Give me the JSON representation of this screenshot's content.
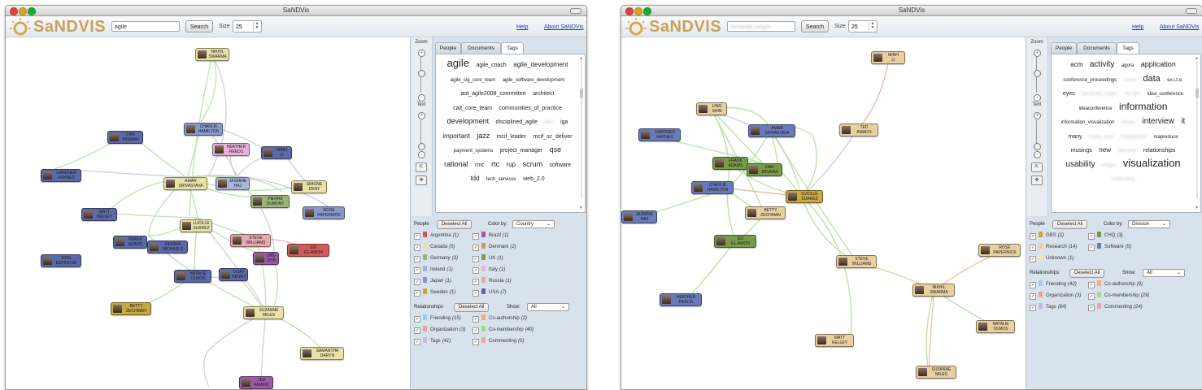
{
  "windows": [
    {
      "title": "SaNDVis",
      "logo": "SaNDVIS",
      "search": {
        "value": "agile",
        "placeholder": "",
        "button": "Search"
      },
      "size": {
        "label": "Size",
        "value": "25"
      },
      "links": {
        "help": "Help",
        "about": "About SaNDVis"
      },
      "zoom": {
        "zoom_label": "Zoom",
        "text_label": "Text"
      },
      "tabs": [
        {
          "label": "People",
          "active": false
        },
        {
          "label": "Documents",
          "active": false
        },
        {
          "label": "Tags",
          "active": true
        }
      ],
      "tags": [
        {
          "text": "agile",
          "size": 13,
          "blur": false
        },
        {
          "text": "agile_coach",
          "size": 7,
          "blur": false
        },
        {
          "text": "agile_development",
          "size": 8,
          "blur": false
        },
        {
          "text": "agile_sig_core_team",
          "size": 6,
          "blur": false
        },
        {
          "text": "agile_software_development",
          "size": 6,
          "blur": false
        },
        {
          "text": "aot_agile2008_committee",
          "size": 7,
          "blur": false
        },
        {
          "text": "architect",
          "size": 7,
          "blur": false
        },
        {
          "text": "cait_core_team",
          "size": 7,
          "blur": false
        },
        {
          "text": "communities_of_practice",
          "size": 7,
          "blur": false
        },
        {
          "text": "development",
          "size": 9,
          "blur": false
        },
        {
          "text": "disciplined_agile",
          "size": 7,
          "blur": false
        },
        {
          "text": "ibm",
          "size": 7,
          "blur": true
        },
        {
          "text": "iga",
          "size": 7,
          "blur": false
        },
        {
          "text": "important",
          "size": 8,
          "blur": false
        },
        {
          "text": "jazz",
          "size": 9,
          "blur": false
        },
        {
          "text": "mcif_leader",
          "size": 7,
          "blur": false
        },
        {
          "text": "mcif_sc_deliver",
          "size": 7,
          "blur": false
        },
        {
          "text": "payment_systems",
          "size": 6,
          "blur": false
        },
        {
          "text": "project_manager",
          "size": 7,
          "blur": false
        },
        {
          "text": "qse",
          "size": 9,
          "blur": false
        },
        {
          "text": "rational",
          "size": 9,
          "blur": false
        },
        {
          "text": "rmc",
          "size": 7,
          "blur": false
        },
        {
          "text": "rtc",
          "size": 9,
          "blur": false
        },
        {
          "text": "rup",
          "size": 8,
          "blur": false
        },
        {
          "text": "scrum",
          "size": 9,
          "blur": false
        },
        {
          "text": "software",
          "size": 7,
          "blur": false
        },
        {
          "text": "tdd",
          "size": 8,
          "blur": false
        },
        {
          "text": "tech_services",
          "size": 6,
          "blur": false
        },
        {
          "text": "web_2.0",
          "size": 7,
          "blur": false
        }
      ],
      "people_section": {
        "label": "People",
        "deselect": "Deselect All",
        "colorby_label": "Color by:",
        "colorby_value": "Country"
      },
      "people_items": [
        {
          "label": "Argentina",
          "count": "(1)",
          "color": "#d15a5a"
        },
        {
          "label": "Brazil",
          "count": "(1)",
          "color": "#9a5aa8"
        },
        {
          "label": "Canada",
          "count": "(5)",
          "color": "#e8e2a8"
        },
        {
          "label": "Denmark",
          "count": "(2)",
          "color": "#c0a070"
        },
        {
          "label": "Germany",
          "count": "(3)",
          "color": "#9ab47a"
        },
        {
          "label": "UK",
          "count": "(1)",
          "color": "#7a9a4a"
        },
        {
          "label": "Ireland",
          "count": "(1)",
          "color": "#a8b4d8"
        },
        {
          "label": "Italy",
          "count": "(1)",
          "color": "#e8b0d8"
        },
        {
          "label": "Japan",
          "count": "(1)",
          "color": "#8898cc"
        },
        {
          "label": "Russia",
          "count": "(1)",
          "color": "#e8a8b0"
        },
        {
          "label": "Sweden",
          "count": "(1)",
          "color": "#c8a840"
        },
        {
          "label": "USA",
          "count": "(7)",
          "color": "#5a6aa8"
        }
      ],
      "rel_section": {
        "label": "Relationships",
        "deselect": "Deselect All",
        "show_label": "Show:",
        "show_value": "All"
      },
      "rel_items": [
        {
          "label": "Friending",
          "count": "(15)",
          "color": "#a8c8e8"
        },
        {
          "label": "Co-authorship",
          "count": "(2)",
          "color": "#f0b080"
        },
        {
          "label": "Organization",
          "count": "(3)",
          "color": "#e8a0a0"
        },
        {
          "label": "Co-membership",
          "count": "(40)",
          "color": "#a8d890"
        },
        {
          "label": "Tags",
          "count": "(41)",
          "color": "#c8b8e0"
        },
        {
          "label": "Commenting",
          "count": "(0)",
          "color": "#e8a8a8"
        }
      ],
      "nodes": [
        {
          "line1": "NIKHIL",
          "line2": "SWARMA",
          "color": "#e8e2a8"
        },
        {
          "line1": "CHARLIE",
          "line2": "HAMILTON",
          "color": "#8898cc"
        },
        {
          "line1": "DAN",
          "line2": "MISAWA",
          "color": "#5a6aa8"
        },
        {
          "line1": "HEATHER",
          "line2": "REEDS",
          "color": "#e8b0d8"
        },
        {
          "line1": "MINH",
          "line2": "LI",
          "color": "#5a6aa8"
        },
        {
          "line1": "GARDNER",
          "line2": "RAYNES",
          "color": "#5a6aa8"
        },
        {
          "line1": "AMAR",
          "line2": "SRIVASTAVA",
          "color": "#e8e2a8"
        },
        {
          "line1": "JASMINE",
          "line2": "HAJ",
          "color": "#a8b4d8"
        },
        {
          "line1": "SIMONE",
          "line2": "DRAY",
          "color": "#e8e2a8"
        },
        {
          "line1": "PIERRE",
          "line2": "DUMONT",
          "color": "#9ab47a"
        },
        {
          "line1": "ROSE",
          "line2": "PAPERNICK",
          "color": "#8898cc"
        },
        {
          "line1": "MATT",
          "line2": "KELLEY",
          "color": "#5a6aa8"
        },
        {
          "line1": "LUCILLE",
          "line2": "SUAREZ",
          "color": "#e8e2a8"
        },
        {
          "line1": "FRANK",
          "line2": "ADAMS",
          "color": "#5a6aa8"
        },
        {
          "line1": "DENNIS",
          "line2": "MICHAELS",
          "color": "#5a6aa8"
        },
        {
          "line1": "STEVE",
          "line2": "WILLIAMS",
          "color": "#e8a8b0"
        },
        {
          "line1": "LING",
          "line2": "SHIN",
          "color": "#9a5aa8"
        },
        {
          "line1": "ED",
          "line2": "EL-AMON",
          "color": "#d15a5a"
        },
        {
          "line1": "RON",
          "line2": "ESPINOSA",
          "color": "#5a6aa8"
        },
        {
          "line1": "NATALIE",
          "line2": "OLMOS",
          "color": "#5a6aa8"
        },
        {
          "line1": "VIJAY",
          "line2": "HENRY",
          "color": "#5a6aa8"
        },
        {
          "line1": "BETTY",
          "line2": "ZECHMAN",
          "color": "#c8a840"
        },
        {
          "line1": "SUZANNE",
          "line2": "MILES",
          "color": "#e8e2a8"
        },
        {
          "line1": "SAMANTHA",
          "line2": "DARYN",
          "color": "#e8e2a8"
        },
        {
          "line1": "TED",
          "line2": "AMADO",
          "color": "#9a5aa8"
        }
      ]
    },
    {
      "title": "SaNDVis",
      "logo": "SaNDVIS",
      "search": {
        "value": "fernanda viegas",
        "placeholder": "",
        "button": "Search"
      },
      "size": {
        "label": "Size",
        "value": "25"
      },
      "links": {
        "help": "Help",
        "about": "About SaNDVis"
      },
      "zoom": {
        "zoom_label": "Zoom",
        "text_label": "Text"
      },
      "tabs": [
        {
          "label": "People",
          "active": false
        },
        {
          "label": "Documents",
          "active": false
        },
        {
          "label": "Tags",
          "active": true
        }
      ],
      "tags": [
        {
          "text": "acm",
          "size": 8,
          "blur": false
        },
        {
          "text": "activity",
          "size": 10,
          "blur": false
        },
        {
          "text": "agora",
          "size": 6,
          "blur": false
        },
        {
          "text": "application",
          "size": 9,
          "blur": false
        },
        {
          "text": "conference_proceedings",
          "size": 6,
          "blur": false
        },
        {
          "text": "social",
          "size": 6,
          "blur": true
        },
        {
          "text": "data",
          "size": 11,
          "blur": false
        },
        {
          "text": "ex.i.t.e.",
          "size": 6,
          "blur": false
        },
        {
          "text": "eyes",
          "size": 7,
          "blur": false
        },
        {
          "text": "fernanda_viegas",
          "size": 6,
          "blur": true
        },
        {
          "text": "hci-ibm",
          "size": 6,
          "blur": true
        },
        {
          "text": "idea_conference",
          "size": 6,
          "blur": false
        },
        {
          "text": "ideaconference",
          "size": 6,
          "blur": false
        },
        {
          "text": "information",
          "size": 12,
          "blur": false
        },
        {
          "text": "information_visualization",
          "size": 6,
          "blur": false
        },
        {
          "text": "infovis",
          "size": 6,
          "blur": true
        },
        {
          "text": "interview",
          "size": 10,
          "blur": false
        },
        {
          "text": "it",
          "size": 10,
          "blur": false
        },
        {
          "text": "many",
          "size": 7,
          "blur": false
        },
        {
          "text": "many_eyes",
          "size": 6,
          "blur": true
        },
        {
          "text": "manyeyes",
          "size": 7,
          "blur": true
        },
        {
          "text": "mapreduce",
          "size": 6,
          "blur": false
        },
        {
          "text": "musings",
          "size": 7,
          "blur": false
        },
        {
          "text": "new",
          "size": 8,
          "blur": false
        },
        {
          "text": "personal",
          "size": 6,
          "blur": true
        },
        {
          "text": "relationships",
          "size": 7,
          "blur": false
        },
        {
          "text": "usability",
          "size": 10,
          "blur": false
        },
        {
          "text": "viegas",
          "size": 6,
          "blur": true
        },
        {
          "text": "visualization",
          "size": 13,
          "blur": false
        },
        {
          "text": "wattenberg",
          "size": 6,
          "blur": true
        }
      ],
      "people_section": {
        "label": "People",
        "deselect": "Deselect All",
        "colorby_label": "Color by:",
        "colorby_value": "Division"
      },
      "people_items": [
        {
          "label": "GBS",
          "count": "(2)",
          "color": "#c8a840"
        },
        {
          "label": "CHQ",
          "count": "(3)",
          "color": "#7a9a4a"
        },
        {
          "label": "Research",
          "count": "(14)",
          "color": "#e8d0a0"
        },
        {
          "label": "Software",
          "count": "(5)",
          "color": "#6a7ab8"
        },
        {
          "label": "Unknown",
          "count": "(1)",
          "color": "#f0e8b0"
        }
      ],
      "rel_section": {
        "label": "Relationships",
        "deselect": "Deselect All",
        "show_label": "Show:",
        "show_value": "All"
      },
      "rel_items": [
        {
          "label": "Friending",
          "count": "(42)",
          "color": "#a8c8e8"
        },
        {
          "label": "Co-authorship",
          "count": "(9)",
          "color": "#f0b080"
        },
        {
          "label": "Organization",
          "count": "(3)",
          "color": "#e8a0a0"
        },
        {
          "label": "Co-membership",
          "count": "(29)",
          "color": "#a8d890"
        },
        {
          "label": "Tags",
          "count": "(84)",
          "color": "#c8b8e0"
        },
        {
          "label": "Commenting",
          "count": "(24)",
          "color": "#e8a8a8"
        }
      ],
      "nodes": [
        {
          "line1": "MINH",
          "line2": "LI",
          "color": "#e8d0a0"
        },
        {
          "line1": "LING",
          "line2": "SHIN",
          "color": "#e8d0a0"
        },
        {
          "line1": "TED",
          "line2": "AMADO",
          "color": "#e8d0a0"
        },
        {
          "line1": "GARDNER",
          "line2": "RAYNES",
          "color": "#6a7ab8"
        },
        {
          "line1": "AMAR",
          "line2": "SRIVASTAVA",
          "color": "#6a7ab8"
        },
        {
          "line1": "FRANK",
          "line2": "ADAMS",
          "color": "#7a9a4a"
        },
        {
          "line1": "DAN",
          "line2": "MISAWA",
          "color": "#7a9a4a"
        },
        {
          "line1": "CHARLIE",
          "line2": "HAMILTON",
          "color": "#6a7ab8"
        },
        {
          "line1": "LUCILLE",
          "line2": "SUAREZ",
          "color": "#c8a840"
        },
        {
          "line1": "JASMINE",
          "line2": "HAJ",
          "color": "#6a7ab8"
        },
        {
          "line1": "BETTY",
          "line2": "ZECHMAN",
          "color": "#e8d0a0"
        },
        {
          "line1": "ED",
          "line2": "EL-AMON",
          "color": "#7a9a4a"
        },
        {
          "line1": "STEVE",
          "line2": "WILLIAMS",
          "color": "#e8d0a0"
        },
        {
          "line1": "ROSE",
          "line2": "PAPERNICK",
          "color": "#e8d0a0"
        },
        {
          "line1": "NIKHIL",
          "line2": "SWARMA",
          "color": "#e8d0a0"
        },
        {
          "line1": "HEATHER",
          "line2": "REEDS",
          "color": "#6a7ab8"
        },
        {
          "line1": "NATALIE",
          "line2": "OLMOS",
          "color": "#e8d0a0"
        },
        {
          "line1": "MATT",
          "line2": "KELLEY",
          "color": "#e8d0a0"
        },
        {
          "line1": "SUZANNE",
          "line2": "MILES",
          "color": "#e8d0a0"
        }
      ]
    }
  ]
}
